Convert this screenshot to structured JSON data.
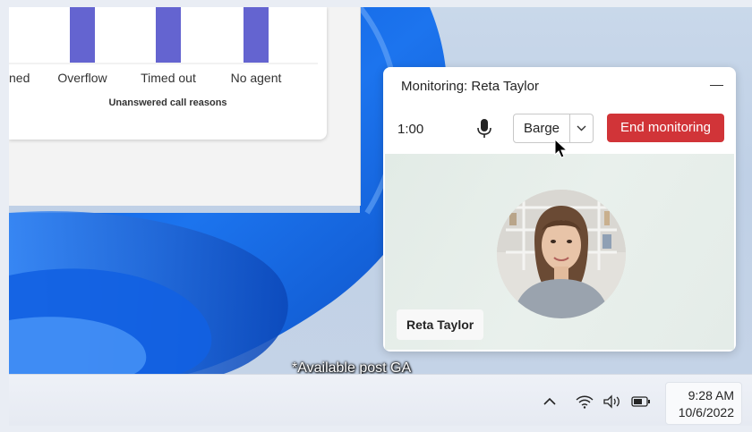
{
  "chart": {
    "categories": [
      "ned",
      "Overflow",
      "Timed out",
      "No agent"
    ],
    "title": "Unanswered call reasons",
    "bar_color": "#6464d0"
  },
  "monitoring": {
    "title": "Monitoring: Reta Taylor",
    "timer": "1:00",
    "barge_label": "Barge",
    "end_label": "End monitoring",
    "participant_name": "Reta Taylor",
    "end_color": "#d13438"
  },
  "caption": "*Available post GA",
  "taskbar": {
    "time": "9:28 AM",
    "date": "10/6/2022",
    "icons": [
      "chevron-up-icon",
      "wifi-icon",
      "volume-icon",
      "battery-icon"
    ]
  }
}
